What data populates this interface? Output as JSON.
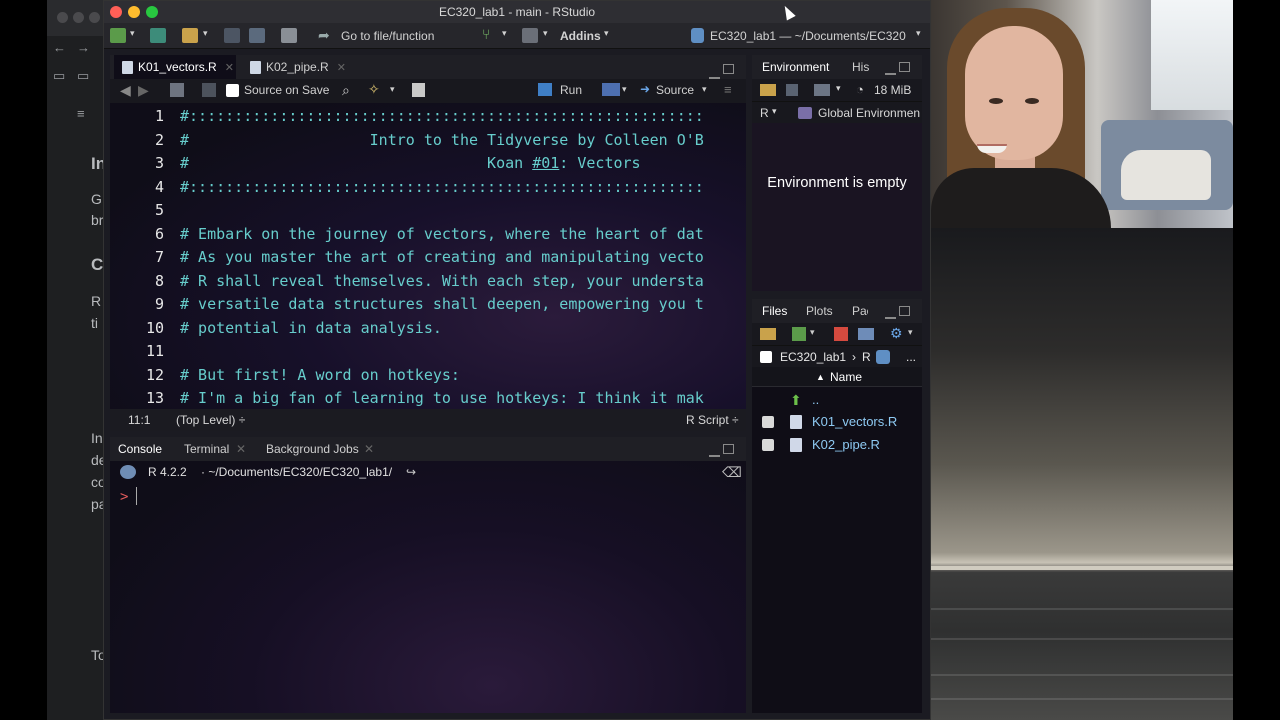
{
  "window": {
    "title": "EC320_lab1 - main - RStudio",
    "lights": [
      "#ff5f57",
      "#febc2e",
      "#28c840"
    ]
  },
  "toolbar": {
    "goto": "Go to file/function",
    "addins": "Addins",
    "project": "EC320_lab1 — ~/Documents/EC320"
  },
  "editor": {
    "tabs": [
      {
        "label": "K01_vectors.R",
        "active": true
      },
      {
        "label": "K02_pipe.R",
        "active": false
      }
    ],
    "source_on_save": "Source on Save",
    "run": "Run",
    "source": "Source",
    "lines": [
      {
        "n": "1",
        "text": "#:::::::::::::::::::::::::::::::::::::::::::::::::::::::::"
      },
      {
        "n": "2",
        "text": "#                    Intro to the Tidyverse by Colleen O'B"
      },
      {
        "n": "3",
        "text": "#                                 Koan #01: Vectors"
      },
      {
        "n": "4",
        "text": "#:::::::::::::::::::::::::::::::::::::::::::::::::::::::::"
      },
      {
        "n": "5",
        "text": ""
      },
      {
        "n": "6",
        "text": "# Embark on the journey of vectors, where the heart of dat"
      },
      {
        "n": "7",
        "text": "# As you master the art of creating and manipulating vecto"
      },
      {
        "n": "8",
        "text": "# R shall reveal themselves. With each step, your understa"
      },
      {
        "n": "9",
        "text": "# versatile data structures shall deepen, empowering you t"
      },
      {
        "n": "10",
        "text": "# potential in data analysis."
      },
      {
        "n": "11",
        "text": ""
      },
      {
        "n": "12",
        "text": "# But first! A word on hotkeys:"
      },
      {
        "n": "13",
        "text": "# I'm a big fan of learning to use hotkeys: I think it mak"
      }
    ],
    "status_pos": "11:1",
    "status_scope": "(Top Level) ÷",
    "status_type": "R Script ÷"
  },
  "console": {
    "tabs": [
      {
        "label": "Console",
        "active": true
      },
      {
        "label": "Terminal",
        "active": false
      },
      {
        "label": "Background Jobs",
        "active": false
      }
    ],
    "version": "R 4.2.2",
    "path": "· ~/Documents/EC320/EC320_lab1/",
    "prompt": ">"
  },
  "environment": {
    "tabs": [
      "Environment",
      "His"
    ],
    "memory": "18 MiB",
    "lang": "R",
    "scope": "Global Environmen",
    "empty_msg": "Environment is empty"
  },
  "files": {
    "tabs": [
      "Files",
      "Plots",
      "Pac"
    ],
    "crumb_project": "EC320_lab1",
    "crumb_sep": "R",
    "crumb_more": "...",
    "col_name": "Name",
    "parent": "..",
    "items": [
      "K01_vectors.R",
      "K02_pipe.R"
    ]
  },
  "background_browser": {
    "fragments": [
      "In",
      "G",
      "br",
      "C",
      "R",
      "ti",
      "In",
      "de",
      "co",
      "pa",
      "To"
    ]
  }
}
